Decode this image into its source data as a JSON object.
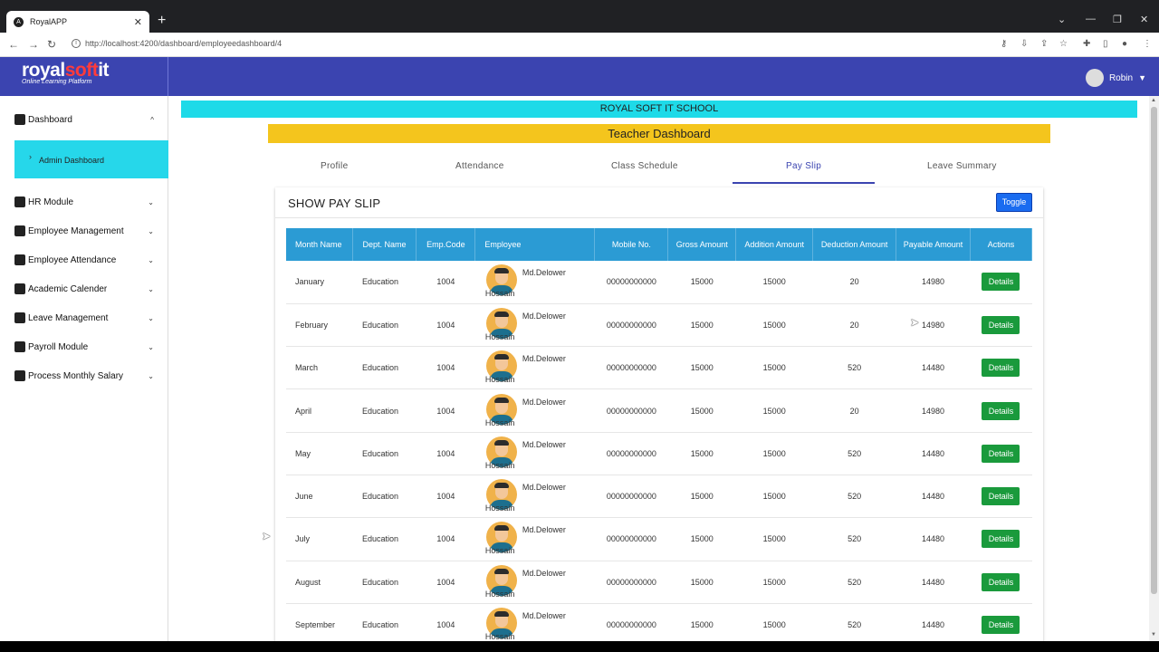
{
  "browser": {
    "tab_title": "RoyalAPP",
    "url": "http://localhost:4200/dashboard/employeedashboard/4"
  },
  "header": {
    "logo_a": "royal",
    "logo_b": "soft",
    "logo_c": "it",
    "tagline": "Online Learning Platform",
    "user_name": "Robin"
  },
  "sidebar": {
    "items": [
      {
        "label": "Dashboard",
        "icon": "dashboard-icon",
        "chev": "^"
      },
      {
        "label": "HR Module",
        "icon": "hr-icon",
        "chev": "⌄"
      },
      {
        "label": "Employee Management",
        "icon": "people-icon",
        "chev": "⌄"
      },
      {
        "label": "Employee Attendance",
        "icon": "calendar-check-icon",
        "chev": "⌄"
      },
      {
        "label": "Academic Calender",
        "icon": "calendar-icon",
        "chev": "⌄"
      },
      {
        "label": "Leave Management",
        "icon": "settings-icon",
        "chev": "⌄"
      },
      {
        "label": "Payroll Module",
        "icon": "payroll-icon",
        "chev": "⌄"
      },
      {
        "label": "Process Monthly Salary",
        "icon": "salary-icon",
        "chev": "⌄"
      }
    ],
    "sub_item": "Admin Dashboard"
  },
  "main": {
    "school": "ROYAL SOFT IT SCHOOL",
    "title": "Teacher Dashboard",
    "tabs": [
      "Profile",
      "Attendance",
      "Class Schedule",
      "Pay Slip",
      "Leave Summary"
    ],
    "card_title": "SHOW PAY SLIP",
    "toggle": "Toggle"
  },
  "table": {
    "headers": [
      "Month Name",
      "Dept. Name",
      "Emp.Code",
      "Employee",
      "Mobile No.",
      "Gross Amount",
      "Addition Amount",
      "Deduction Amount",
      "Payable Amount",
      "Actions"
    ],
    "rows": [
      {
        "month": "January",
        "dept": "Education",
        "code": "1004",
        "fn": "Md.Delower",
        "ln": "Hossain",
        "mobile": "00000000000",
        "gross": "15000",
        "addition": "15000",
        "deduction": "20",
        "payable": "14980",
        "action": "Details"
      },
      {
        "month": "February",
        "dept": "Education",
        "code": "1004",
        "fn": "Md.Delower",
        "ln": "Hossain",
        "mobile": "00000000000",
        "gross": "15000",
        "addition": "15000",
        "deduction": "20",
        "payable": "14980",
        "action": "Details"
      },
      {
        "month": "March",
        "dept": "Education",
        "code": "1004",
        "fn": "Md.Delower",
        "ln": "Hossain",
        "mobile": "00000000000",
        "gross": "15000",
        "addition": "15000",
        "deduction": "520",
        "payable": "14480",
        "action": "Details"
      },
      {
        "month": "April",
        "dept": "Education",
        "code": "1004",
        "fn": "Md.Delower",
        "ln": "Hossain",
        "mobile": "00000000000",
        "gross": "15000",
        "addition": "15000",
        "deduction": "20",
        "payable": "14980",
        "action": "Details"
      },
      {
        "month": "May",
        "dept": "Education",
        "code": "1004",
        "fn": "Md.Delower",
        "ln": "Hossain",
        "mobile": "00000000000",
        "gross": "15000",
        "addition": "15000",
        "deduction": "520",
        "payable": "14480",
        "action": "Details"
      },
      {
        "month": "June",
        "dept": "Education",
        "code": "1004",
        "fn": "Md.Delower",
        "ln": "Hossain",
        "mobile": "00000000000",
        "gross": "15000",
        "addition": "15000",
        "deduction": "520",
        "payable": "14480",
        "action": "Details"
      },
      {
        "month": "July",
        "dept": "Education",
        "code": "1004",
        "fn": "Md.Delower",
        "ln": "Hossain",
        "mobile": "00000000000",
        "gross": "15000",
        "addition": "15000",
        "deduction": "520",
        "payable": "14480",
        "action": "Details"
      },
      {
        "month": "August",
        "dept": "Education",
        "code": "1004",
        "fn": "Md.Delower",
        "ln": "Hossain",
        "mobile": "00000000000",
        "gross": "15000",
        "addition": "15000",
        "deduction": "520",
        "payable": "14480",
        "action": "Details"
      },
      {
        "month": "September",
        "dept": "Education",
        "code": "1004",
        "fn": "Md.Delower",
        "ln": "Hossain",
        "mobile": "00000000000",
        "gross": "15000",
        "addition": "15000",
        "deduction": "520",
        "payable": "14480",
        "action": "Details"
      }
    ]
  },
  "colors": {
    "header": "#3b44b0",
    "school_bar": "#1edae8",
    "title_bar": "#f4c51d",
    "table_header": "#2b9bd4",
    "details_button": "#1a9a3c",
    "toggle_button": "#1a6cf0"
  }
}
